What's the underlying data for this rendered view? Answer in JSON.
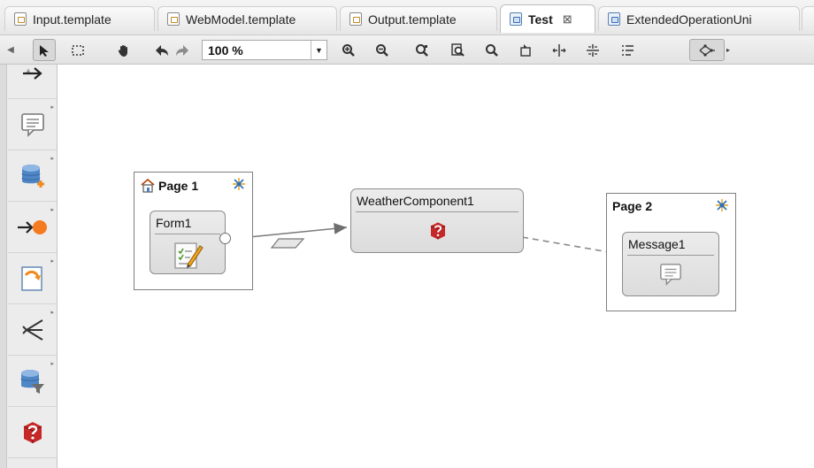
{
  "tabs": [
    {
      "label": "Input.template",
      "icon": "template-icon",
      "active": false
    },
    {
      "label": "WebModel.template",
      "icon": "template-icon",
      "active": false
    },
    {
      "label": "Output.template",
      "icon": "template-icon",
      "active": false
    },
    {
      "label": "Test",
      "icon": "diagram-icon",
      "active": true,
      "close": "⊠"
    },
    {
      "label": "ExtendedOperationUni",
      "icon": "operation-icon",
      "active": false
    }
  ],
  "toolbar": {
    "zoom_value": "100 %",
    "tools": [
      "select-arrow",
      "marquee",
      "hand",
      "undo",
      "redo",
      "zoom-in",
      "zoom-out",
      "zoom-fit",
      "zoom-page",
      "zoom-selection",
      "highlight",
      "align-horizontal",
      "align-vertical",
      "list-layout",
      "auto-layout"
    ]
  },
  "palette": {
    "items": [
      "flow-arrow",
      "message",
      "add-entity",
      "ok-link",
      "module",
      "switch",
      "filter",
      "component"
    ]
  },
  "diagram": {
    "page1": {
      "title": "Page 1",
      "form": "Form1"
    },
    "component": {
      "title": "WeatherComponent1"
    },
    "page2": {
      "title": "Page 2",
      "message": "Message1"
    }
  },
  "colors": {
    "accent": "#e8632b",
    "selected_tab": "#ffffff",
    "node_fill": "#e2e2e2"
  }
}
